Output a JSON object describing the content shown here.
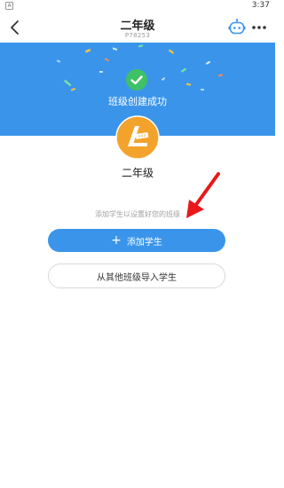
{
  "status_bar": {
    "left_icon": "A",
    "time": "3:37"
  },
  "header": {
    "title": "二年级",
    "subtitle": "P78253",
    "back_icon": "chevron-left-icon",
    "robot_icon": "robot-icon",
    "more_icon": "more-dots-icon"
  },
  "banner": {
    "success_text": "班级创建成功",
    "check_icon": "checkmark-icon",
    "color": "#3a95ea"
  },
  "class_info": {
    "name": "二年级"
  },
  "hint": "添加学生以设置好您的班级",
  "actions": {
    "add_student": "添加学生",
    "import_students": "从其他班级导入学生"
  },
  "colors": {
    "accent": "#3a95ea",
    "success": "#3fc166",
    "arrow": "#e8181b",
    "logo": "#f3a32c"
  }
}
